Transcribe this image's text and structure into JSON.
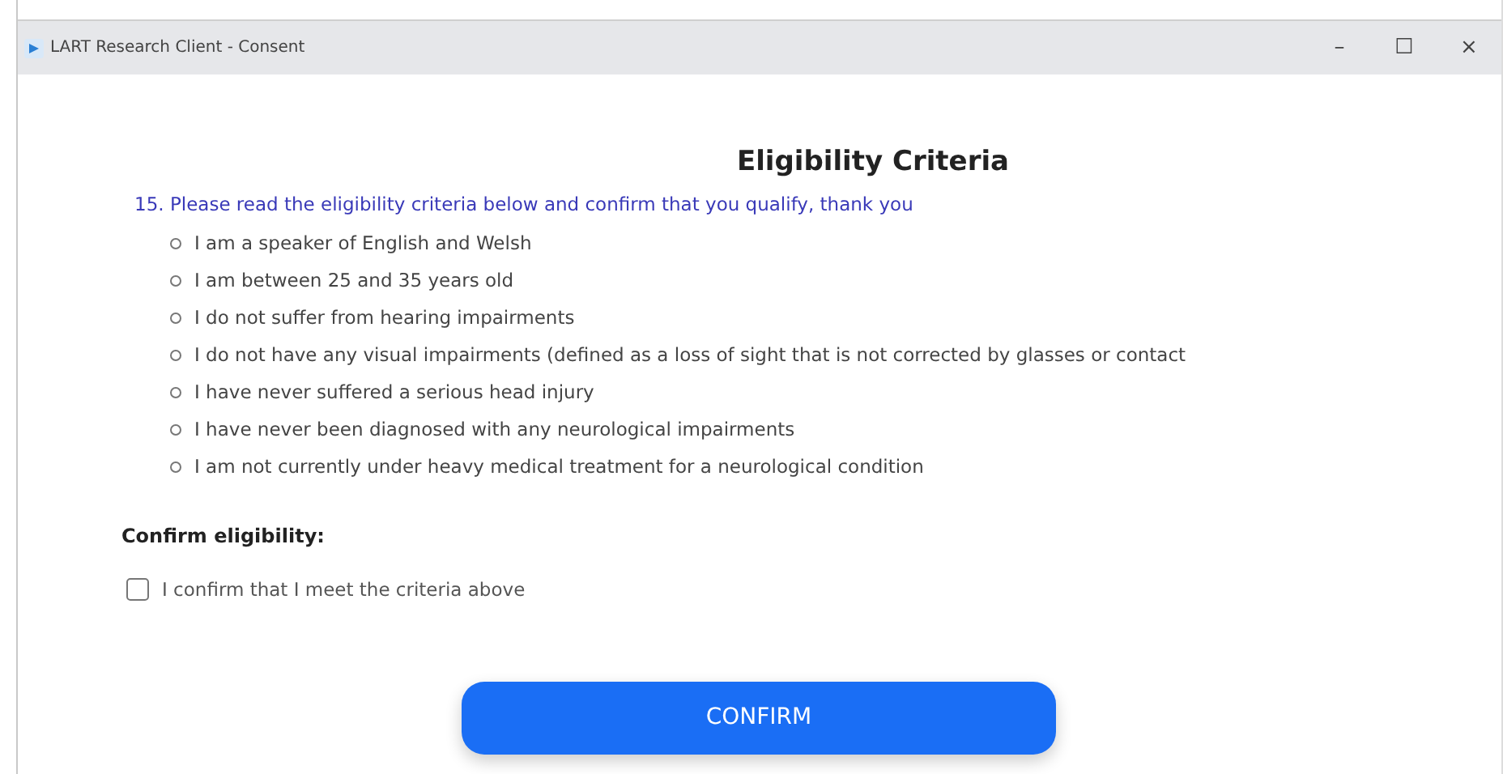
{
  "window": {
    "title": "LART Research Client - Consent",
    "controls": [
      "–",
      "☐",
      "×"
    ]
  },
  "heading": "Eligibility Criteria",
  "question": "15. Please read the eligibility criteria below and confirm that you qualify, thank you",
  "criteria": [
    "I am a speaker of English and Welsh",
    "I am between 25 and 35 years old",
    "I do not suffer from hearing impairments",
    "I do not have any visual impairments (defined as a loss of sight that is not corrected by glasses or contact",
    "I have never suffered a serious head injury",
    "I have never been diagnosed with any neurological impairments",
    "I am not currently under heavy medical treatment for a neurological condition"
  ],
  "confirm_label": "Confirm eligibility:",
  "checkbox": {
    "label": "I confirm that I meet the criteria above",
    "checked": false
  },
  "button": "CONFIRM"
}
